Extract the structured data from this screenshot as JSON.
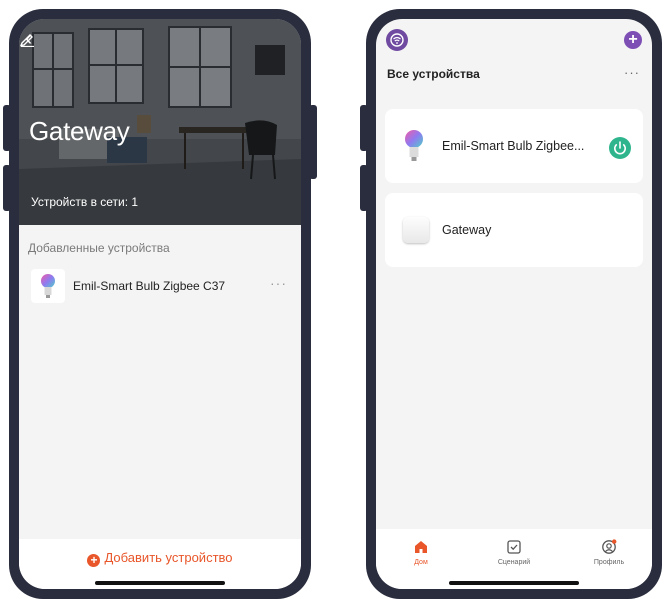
{
  "left_screen": {
    "title": "Gateway",
    "online_text": "Устройств в сети: 1",
    "section_label": "Добавленные устройства",
    "device": {
      "name": "Emil-Smart Bulb Zigbee C37",
      "more": "···"
    },
    "add_button": "Добавить устройство"
  },
  "right_screen": {
    "header_title": "Все устройства",
    "header_more": "···",
    "devices": [
      {
        "name": "Emil-Smart Bulb Zigbee...",
        "power_on": true
      },
      {
        "name": "Gateway"
      }
    ],
    "tabs": [
      {
        "label": "Дом",
        "icon": "home-icon",
        "active": true
      },
      {
        "label": "Сценарий",
        "icon": "checkbox-icon"
      },
      {
        "label": "Профиль",
        "icon": "profile-icon"
      }
    ]
  },
  "colors": {
    "accent_orange": "#e8562a",
    "power_green": "#2fb58d",
    "plus_purple": "#7d4fb5",
    "phone_frame": "#2a2d3e"
  }
}
